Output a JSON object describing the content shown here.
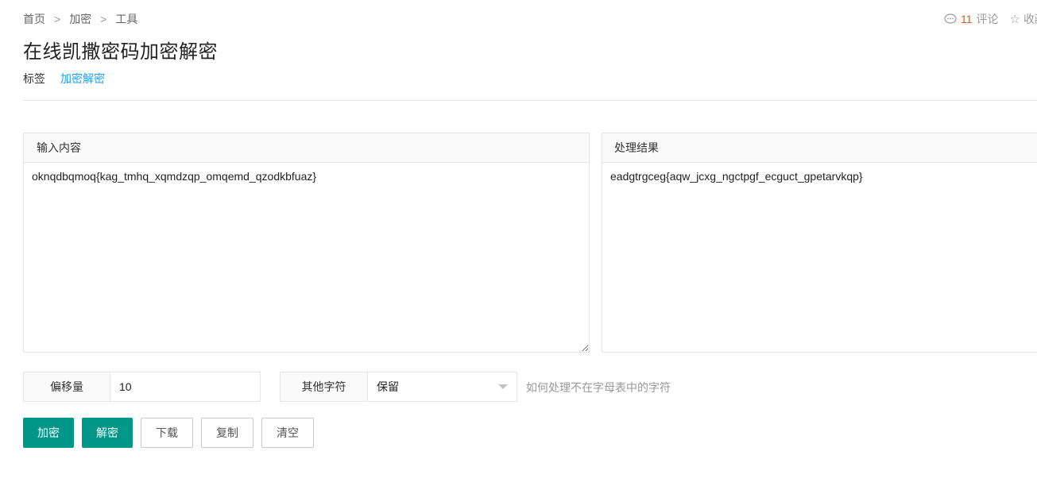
{
  "breadcrumb": {
    "items": [
      "首页",
      "加密",
      "工具"
    ],
    "separator": ">"
  },
  "meta": {
    "comment_count": "11",
    "comment_label": "评论",
    "favorite_label": "收藏"
  },
  "page": {
    "title": "在线凯撒密码加密解密"
  },
  "tags": {
    "label": "标签",
    "items": [
      "加密解密"
    ]
  },
  "input_panel": {
    "header": "输入内容",
    "value": "oknqdbqmoq{kag_tmhq_xqmdzqp_omqemd_qzodkbfuaz}"
  },
  "output_panel": {
    "header": "处理结果",
    "value": "eadgtrgceg{aqw_jcxg_ngctpgf_ecguct_gpetarvkqp}"
  },
  "offset_field": {
    "label": "偏移量",
    "value": "10"
  },
  "other_chars_field": {
    "label": "其他字符",
    "selected": "保留",
    "hint": "如何处理不在字母表中的字符"
  },
  "buttons": {
    "encrypt": "加密",
    "decrypt": "解密",
    "download": "下载",
    "copy": "复制",
    "clear": "清空"
  },
  "colors": {
    "primary": "#009688",
    "link": "#1e9fff",
    "count": "#e2581f"
  }
}
